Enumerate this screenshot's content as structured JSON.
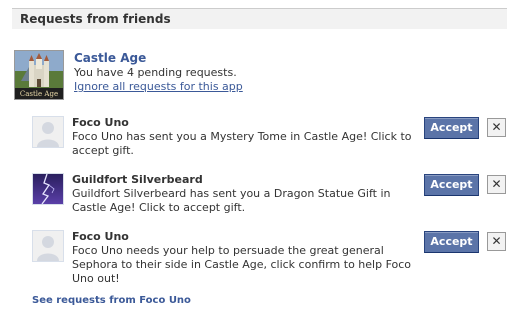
{
  "header": {
    "title": "Requests from friends"
  },
  "app": {
    "name": "Castle Age",
    "pending": "You have 4 pending requests.",
    "ignore_link": "Ignore all requests for this app",
    "icon_caption": "Castle Age",
    "icon": "castle-icon"
  },
  "requests": [
    {
      "sender": "Foco Uno",
      "message": "Foco Uno has sent you a Mystery Tome in Castle Age! Click to accept gift.",
      "avatar": "default-silhouette",
      "accept_label": "Accept",
      "close_label": "✕"
    },
    {
      "sender": "Guildfort Silverbeard",
      "message": "Guildfort Silverbeard has sent you a Dragon Statue Gift in Castle Age! Click to accept gift.",
      "avatar": "lightning-photo",
      "accept_label": "Accept",
      "close_label": "✕"
    },
    {
      "sender": "Foco Uno",
      "message": "Foco Uno needs your help to persuade the great general Sephora to their side in Castle Age, click confirm to help Foco Uno out!",
      "avatar": "default-silhouette",
      "accept_label": "Accept",
      "close_label": "✕"
    }
  ],
  "footer": {
    "see_more": "See requests from Foco Uno"
  },
  "colors": {
    "link": "#3b5998",
    "button_bg": "#5b74a8",
    "header_bg": "#f2f2f2"
  }
}
